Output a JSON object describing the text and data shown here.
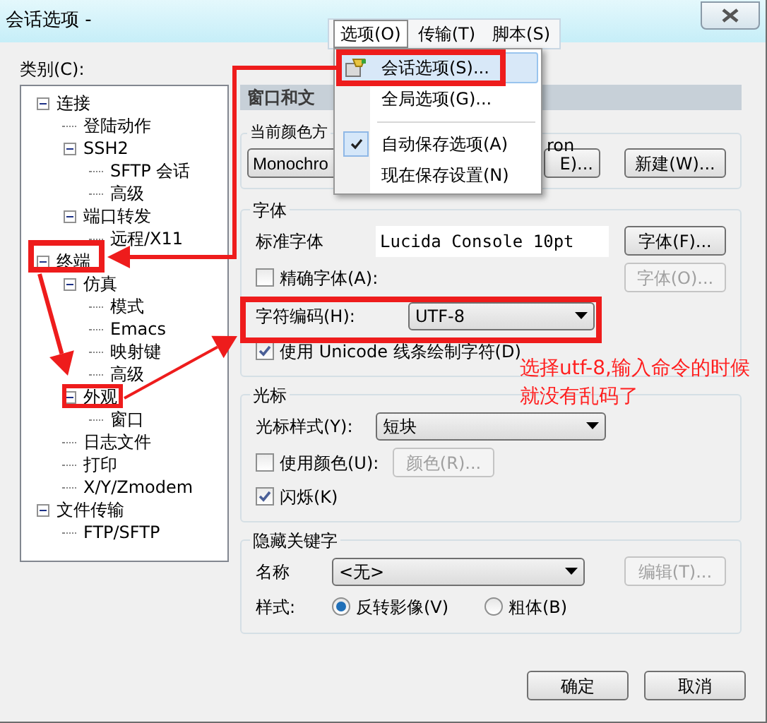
{
  "window": {
    "title": "会话选项 -"
  },
  "category_label": "类别(C):",
  "tree": [
    {
      "label": "连接",
      "expanded": true,
      "children": [
        {
          "label": "登陆动作"
        },
        {
          "label": "SSH2",
          "expanded": true,
          "children": [
            {
              "label": "SFTP 会话"
            },
            {
              "label": "高级"
            }
          ]
        },
        {
          "label": "端口转发",
          "expanded": true,
          "children": [
            {
              "label": "远程/X11"
            }
          ]
        }
      ]
    },
    {
      "label": "终端",
      "expanded": true,
      "children": [
        {
          "label": "仿真",
          "expanded": true,
          "children": [
            {
              "label": "模式"
            },
            {
              "label": "Emacs"
            },
            {
              "label": "映射键"
            },
            {
              "label": "高级"
            }
          ]
        },
        {
          "label": "外观",
          "expanded": true,
          "children": [
            {
              "label": "窗口"
            }
          ]
        },
        {
          "label": "日志文件"
        },
        {
          "label": "打印"
        },
        {
          "label": "X/Y/Zmodem"
        }
      ]
    },
    {
      "label": "文件传输",
      "expanded": true,
      "children": [
        {
          "label": "FTP/SFTP"
        }
      ]
    }
  ],
  "panel": {
    "header": "窗口和文"
  },
  "color_scheme": {
    "legend": "当前颜色方",
    "legend_tail": "ron",
    "scheme_value": "Monochro",
    "edit_button": "E)...",
    "new_button": "新建(W)..."
  },
  "font": {
    "legend": "字体",
    "standard_label": "标准字体",
    "standard_value": "Lucida Console 10pt",
    "font_button": "字体(F)...",
    "exact": {
      "label": "精确字体(A):",
      "checked": false
    },
    "exact_button": {
      "label": "字体(O)...",
      "disabled": true
    },
    "encoding_label": "字符编码(H):",
    "encoding_value": "UTF-8",
    "unicode": {
      "label": "使用 Unicode 线条绘制字符(D)",
      "checked": true
    }
  },
  "cursor": {
    "legend": "光标",
    "style_label": "光标样式(Y):",
    "style_value": "短块",
    "use_color": {
      "label": "使用颜色(U):",
      "checked": false
    },
    "color_button": {
      "label": "颜色(R)...",
      "disabled": true
    },
    "blink": {
      "label": "闪烁(K)",
      "checked": true
    }
  },
  "hidden_keywords": {
    "legend": "隐藏关键字",
    "name_label": "名称",
    "name_value": "<无>",
    "edit_button": {
      "label": "编辑(T)...",
      "disabled": true
    },
    "style_label": "样式:",
    "styles": [
      {
        "label": "反转影像(V)",
        "selected": true
      },
      {
        "label": "粗体(B)",
        "selected": false
      }
    ]
  },
  "buttons": [
    {
      "label": "确定"
    },
    {
      "label": "取消"
    }
  ],
  "menu": {
    "bar": [
      {
        "label": "选项(O)",
        "selected": true
      },
      {
        "label": "传输(T)",
        "selected": false
      },
      {
        "label": "脚本(S)",
        "selected": false
      }
    ],
    "items": [
      {
        "kind": "item",
        "label": "会话选项(S)...",
        "selected": true,
        "checked": false
      },
      {
        "kind": "item",
        "label": "全局选项(G)...",
        "selected": false,
        "checked": false
      },
      {
        "kind": "separator"
      },
      {
        "kind": "item",
        "label": "自动保存选项(A)",
        "selected": false,
        "checked": true
      },
      {
        "kind": "item",
        "label": "现在保存设置(N)",
        "selected": false,
        "checked": false
      }
    ]
  },
  "annotation": {
    "lines": [
      "选择utf-8,输入命令的时候",
      "就没有乱码了"
    ]
  }
}
